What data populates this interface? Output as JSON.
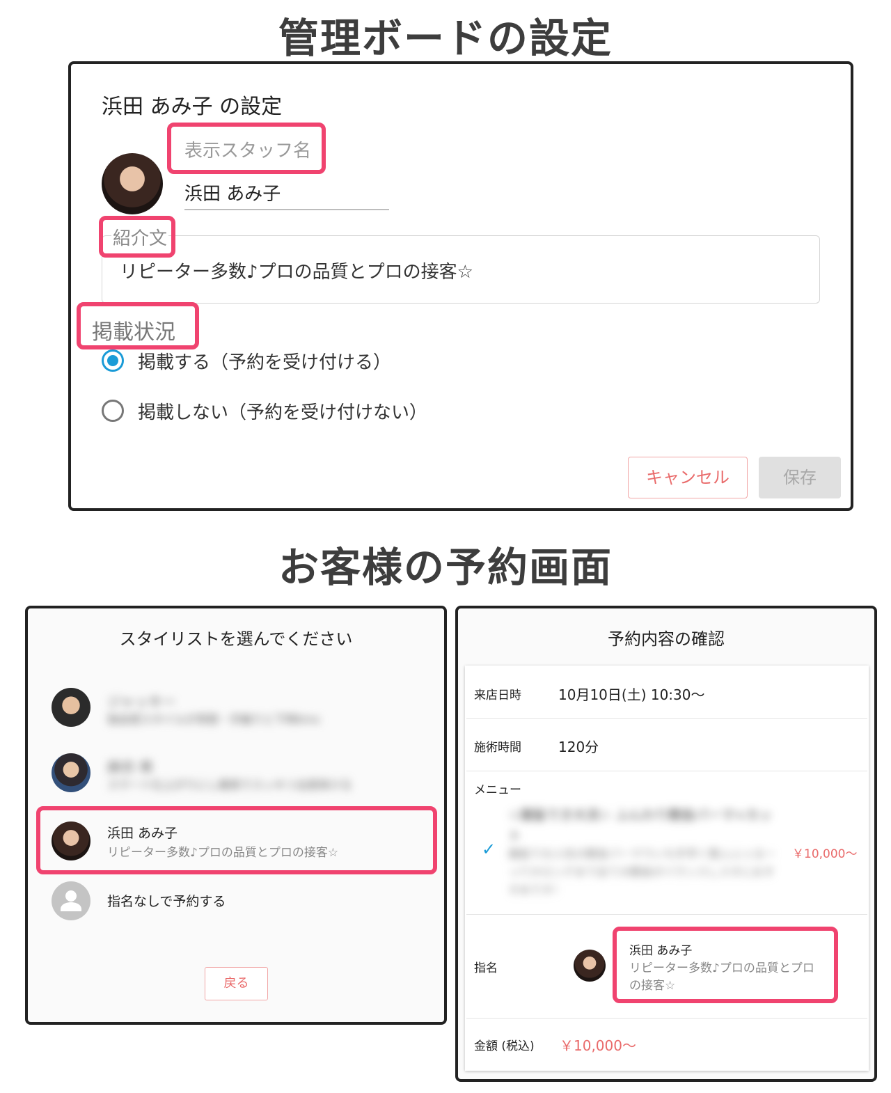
{
  "admin_section": {
    "heading": "管理ボードの設定",
    "dialog_title": "浜田 あみ子 の設定",
    "display_name_label": "表示スタッフ名",
    "display_name_value": "浜田 あみ子",
    "intro_label": "紹介文",
    "intro_value": "リピーター多数♪プロの品質とプロの接客☆",
    "status_label": "掲載状況",
    "status_options": [
      {
        "label": "掲載する（予約を受け付ける）",
        "selected": true
      },
      {
        "label": "掲載しない（予約を受け付けない）",
        "selected": false
      }
    ],
    "cancel_label": "キャンセル",
    "save_label": "保存"
  },
  "customer_section": {
    "heading": "お客様の予約画面",
    "stylist_panel": {
      "title": "スタイリストを選んでください",
      "stylists": [
        {
          "name": "ジャッキー",
          "intro": "独自感スタイルが得意・手触りと下時Kmc",
          "blurred": true
        },
        {
          "name": "麻衣 希",
          "intro": "スマート仕上がりにし確実でスッキリ出感来ける",
          "blurred": true
        },
        {
          "name": "浜田 あみ子",
          "intro": "リピーター多数♪プロの品質とプロの接客☆",
          "blurred": false
        }
      ],
      "no_preference": "指名なしで予約する",
      "back_label": "戻る"
    },
    "confirm_panel": {
      "title": "予約内容の確認",
      "visit_label": "来店日時",
      "visit_value": "10月10日(土) 10:30〜",
      "duration_label": "施術時間",
      "duration_value": "120分",
      "menu_label": "メニュー",
      "menu_name_blurred": "☆魔髪でき大流☆ ふんわり艶抜パーマ+カット",
      "menu_desc_blurred": "魔髪で大人気の艶抜パーマでいち手早く整ふふぅるーってかロングまで全ての艶抜がバランスしスすにおすすめです！",
      "menu_price": "￥10,000〜",
      "nomination_label": "指名",
      "nominee_name": "浜田 あみ子",
      "nominee_intro_line1": "リピーター多数♪プロの品質とプロ",
      "nominee_intro_line2": "の接客☆",
      "total_label": "金額 (税込)",
      "total_value": "￥10,000〜"
    }
  },
  "colors": {
    "highlight": "#f0436f",
    "accent_blue": "#1a9bd7",
    "price_red": "#e96a6a"
  }
}
